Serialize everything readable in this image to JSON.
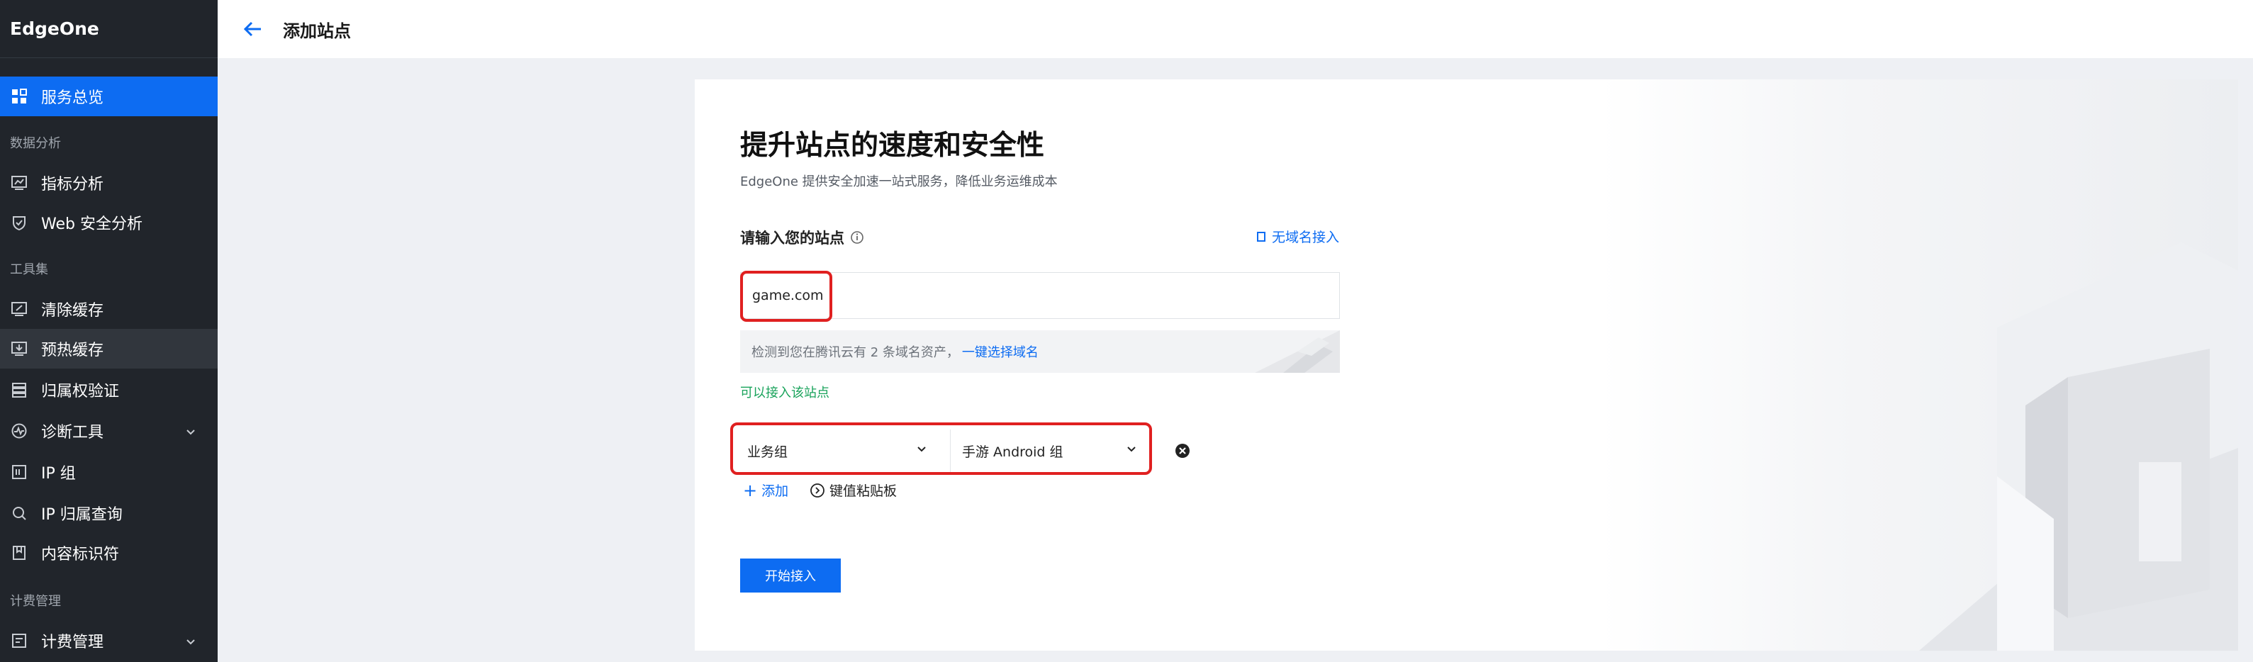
{
  "brand": "EdgeOne",
  "page_title": "添加站点",
  "colors": {
    "accent": "#0d6cf2",
    "sidebar_bg": "#21252b",
    "success": "#19a35b",
    "highlight": "#e02020"
  },
  "sidebar": {
    "items": [
      {
        "label": "服务总览",
        "icon": "grid-icon"
      },
      {
        "label": "指标分析",
        "icon": "chart-icon"
      },
      {
        "label": "Web 安全分析",
        "icon": "shield-icon"
      },
      {
        "label": "清除缓存",
        "icon": "purge-icon"
      },
      {
        "label": "预热缓存",
        "icon": "download-icon"
      },
      {
        "label": "归属权验证",
        "icon": "server-icon"
      },
      {
        "label": "诊断工具",
        "icon": "pulse-icon"
      },
      {
        "label": "IP 组",
        "icon": "ip-icon"
      },
      {
        "label": "IP 归属查询",
        "icon": "search-icon"
      },
      {
        "label": "内容标识符",
        "icon": "bookmark-icon"
      },
      {
        "label": "计费管理",
        "icon": "billing-icon"
      }
    ],
    "sections": [
      "数据分析",
      "工具集",
      "计费管理"
    ]
  },
  "main": {
    "headline": "提升站点的速度和安全性",
    "subline": "EdgeOne 提供安全加速一站式服务，降低业务运维成本",
    "field_label": "请输入您的站点",
    "no_domain_link": "无域名接入",
    "site_value": "game.com",
    "detect_text": "检测到您在腾讯云有 2 条域名资产，",
    "detect_link": "一键选择域名",
    "ok_text": "可以接入该站点",
    "select_group": "业务组",
    "select_value": "手游 Android 组",
    "add_label": "添加",
    "paste_label": "键值粘贴板",
    "start_button": "开始接入"
  }
}
